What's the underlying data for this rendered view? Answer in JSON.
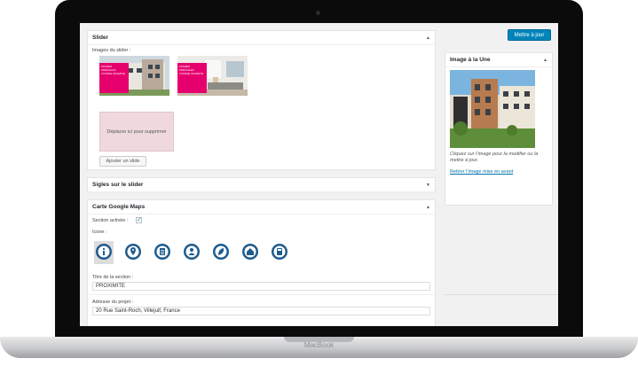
{
  "device": {
    "brand": "MacBook"
  },
  "slider": {
    "title": "Slider",
    "images_label": "Images du slider :",
    "thumb_text": "OFFRES SPÉCIALES CUISINE OFFERTE",
    "dropzone_text": "Déplacer ici pour supprimer",
    "add_button": "Ajouter un slide"
  },
  "sigles": {
    "title": "Sigles sur le slider"
  },
  "map": {
    "title": "Carte Google Maps",
    "section_label": "Section activée :",
    "section_checked": true,
    "icon_label": "Icone :",
    "icons": [
      "info-icon",
      "location-pin-icon",
      "document-icon",
      "person-icon",
      "leaf-icon",
      "home-icon",
      "calculator-icon"
    ],
    "selected_icon_index": 0,
    "section_title_label": "Titre de la section :",
    "section_title_value": "PROXIMITE",
    "address_label": "Adresse du projet :",
    "address_value": "20 Rue Saint-Roch, Villejuif, France"
  },
  "sidebar": {
    "update_button": "Mettre à jour",
    "featured_title": "Image à la Une",
    "featured_desc": "Cliquez sur l’image pour la modifier ou la mettre à jour.",
    "remove_link": "Retirer l’image mise en avant"
  },
  "colors": {
    "accent": "#0085ba",
    "icon_blue": "#1f5b8c",
    "pink": "#e6006e"
  }
}
